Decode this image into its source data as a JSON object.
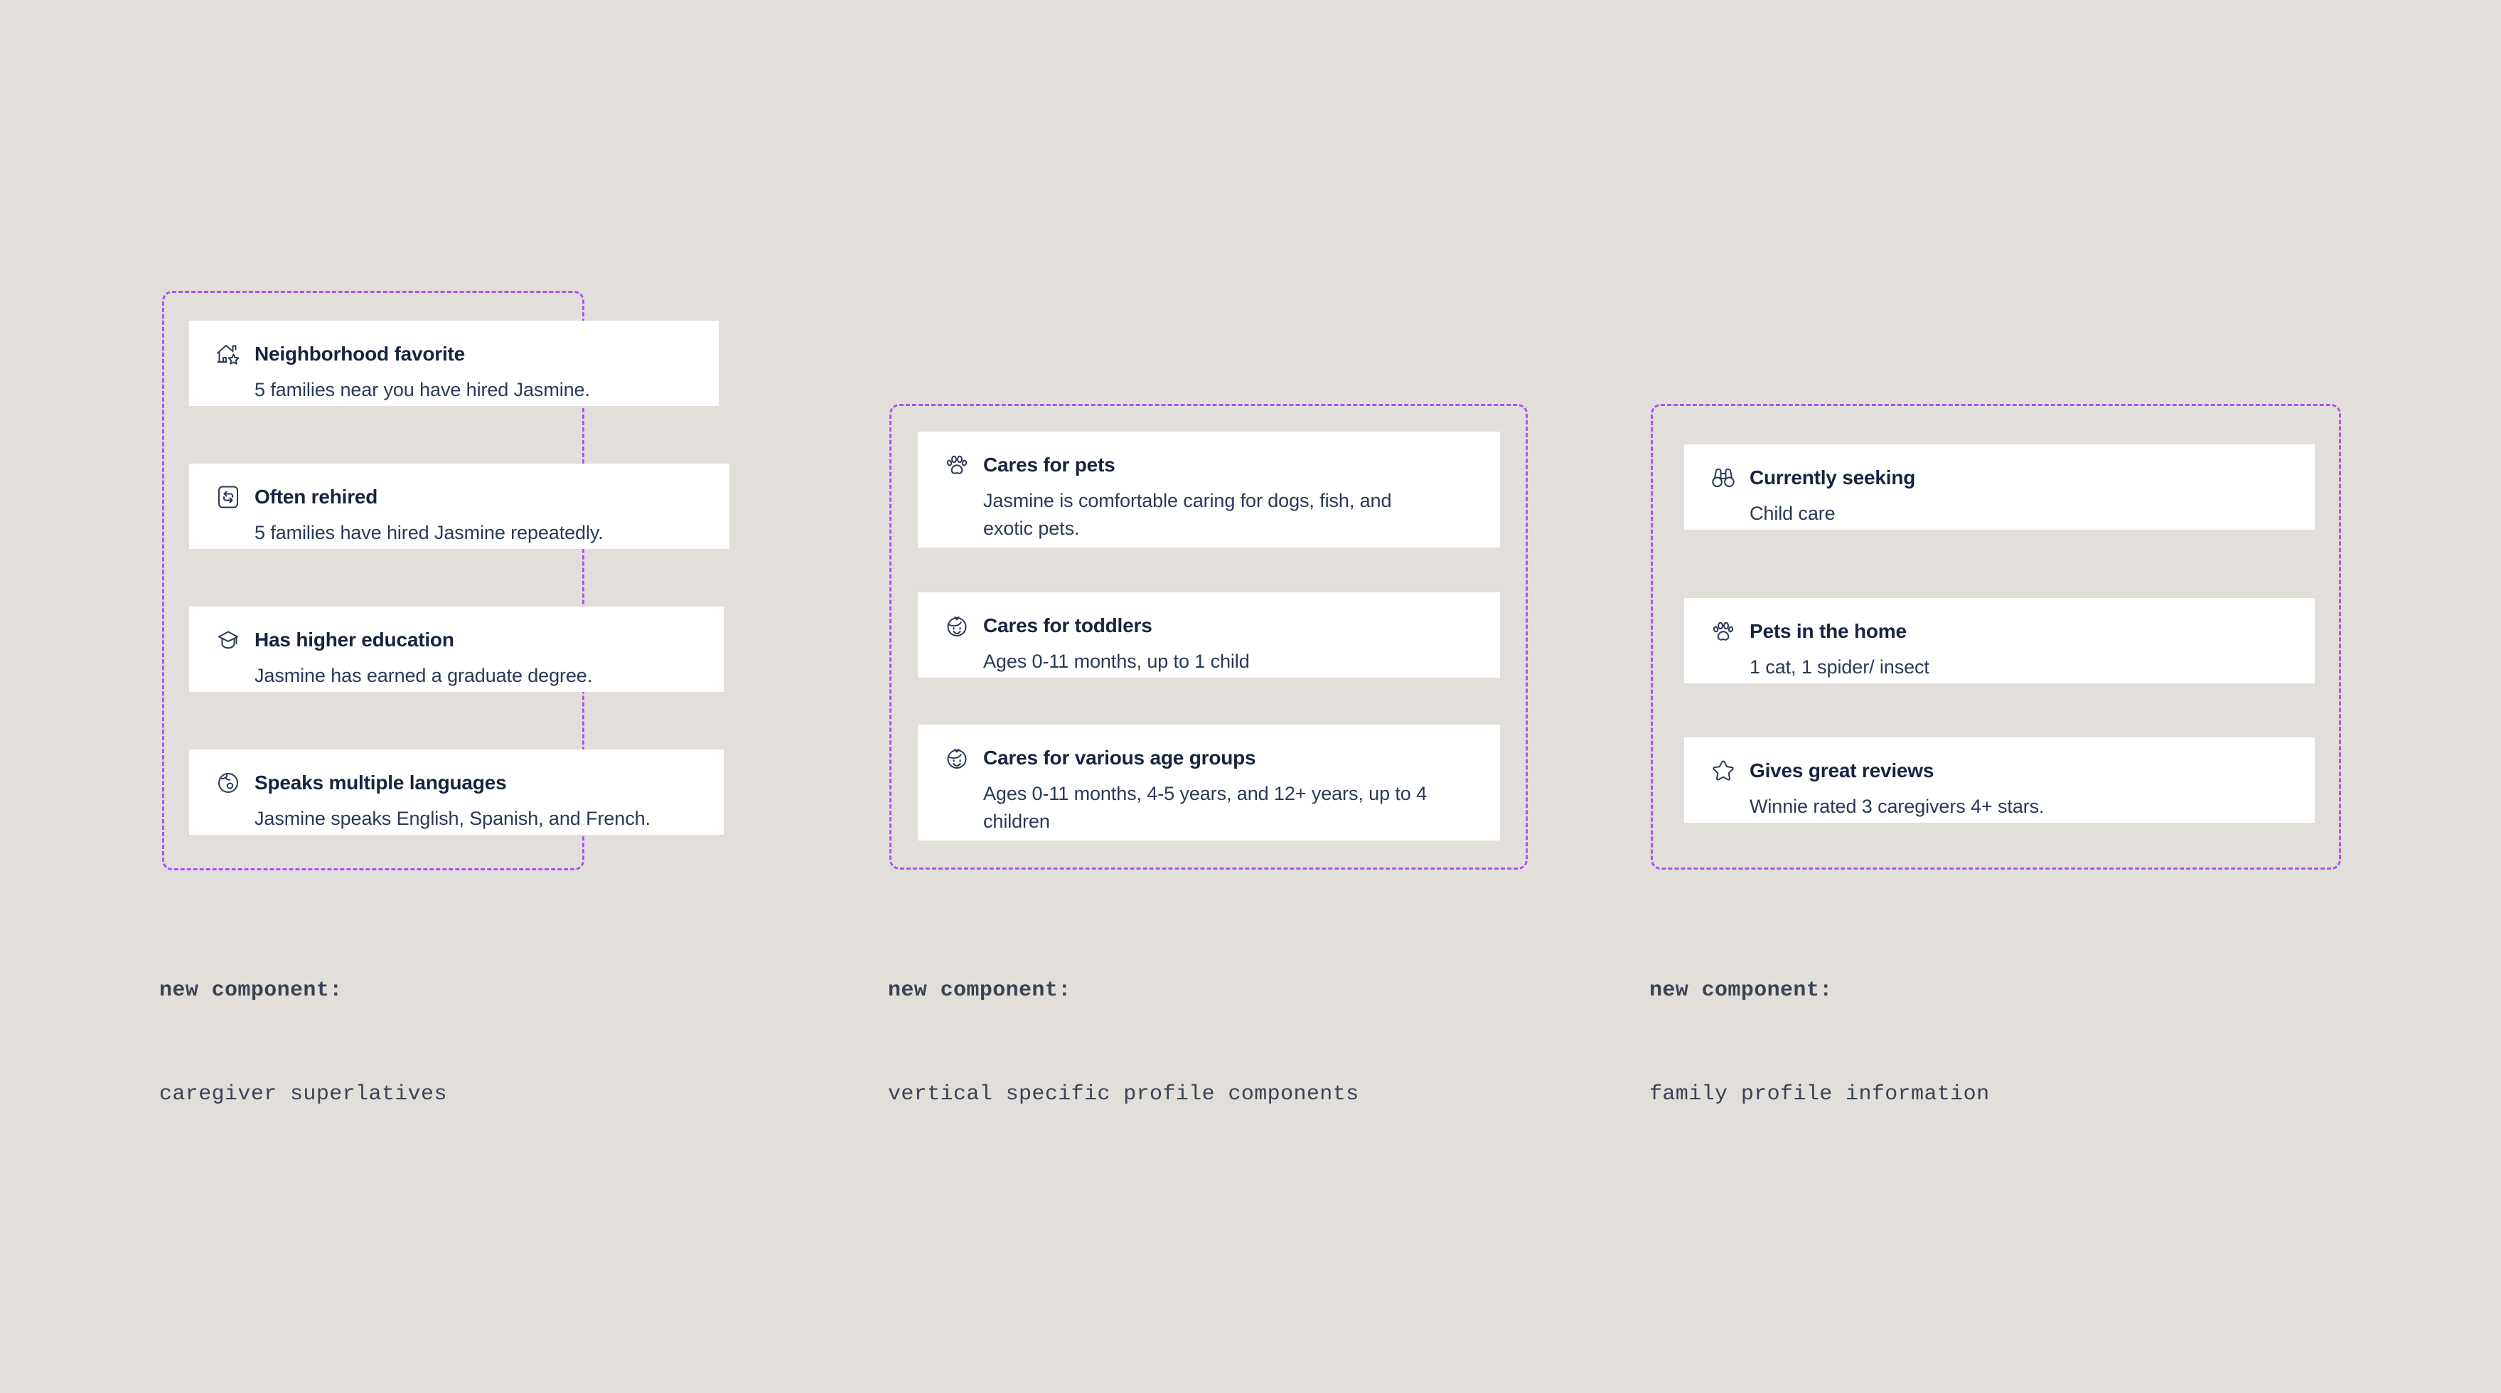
{
  "colors": {
    "background": "#e2dfda",
    "card": "#ffffff",
    "annotation_border": "#a855f7",
    "title_text": "#18233f",
    "body_text": "#2b3857",
    "caption_text": "#3a4254"
  },
  "groups": [
    {
      "id": "caregiver-superlatives",
      "caption_label": "new component:",
      "caption_value": "caregiver superlatives",
      "cards": [
        {
          "icon": "house-star-icon",
          "title": "Neighborhood favorite",
          "body": "5 families near you have hired Jasmine."
        },
        {
          "icon": "repeat-square-icon",
          "title": "Often rehired",
          "body": "5 families have hired Jasmine repeatedly."
        },
        {
          "icon": "graduation-cap-icon",
          "title": "Has higher education",
          "body": "Jasmine has earned a graduate degree."
        },
        {
          "icon": "globe-icon",
          "title": "Speaks multiple languages",
          "body": "Jasmine speaks English, Spanish, and French."
        }
      ]
    },
    {
      "id": "vertical-specific-profile-components",
      "caption_label": "new component:",
      "caption_value": "vertical specific profile components",
      "cards": [
        {
          "icon": "paw-icon",
          "title": "Cares for pets",
          "body": "Jasmine is comfortable caring for dogs, fish, and exotic pets."
        },
        {
          "icon": "child-face-icon",
          "title": "Cares for toddlers",
          "body": "Ages 0-11 months, up to 1 child"
        },
        {
          "icon": "child-face-icon",
          "title": "Cares for various age groups",
          "body": "Ages 0-11 months, 4-5 years, and 12+ years, up to 4 children"
        }
      ]
    },
    {
      "id": "family-profile-information",
      "caption_label": "new component:",
      "caption_value": "family profile information",
      "cards": [
        {
          "icon": "binoculars-icon",
          "title": "Currently seeking",
          "body": "Child care"
        },
        {
          "icon": "paw-icon",
          "title": "Pets in the home",
          "body": "1 cat, 1 spider/ insect"
        },
        {
          "icon": "star-icon",
          "title": "Gives great reviews",
          "body": "Winnie rated 3 caregivers 4+ stars."
        }
      ]
    }
  ]
}
